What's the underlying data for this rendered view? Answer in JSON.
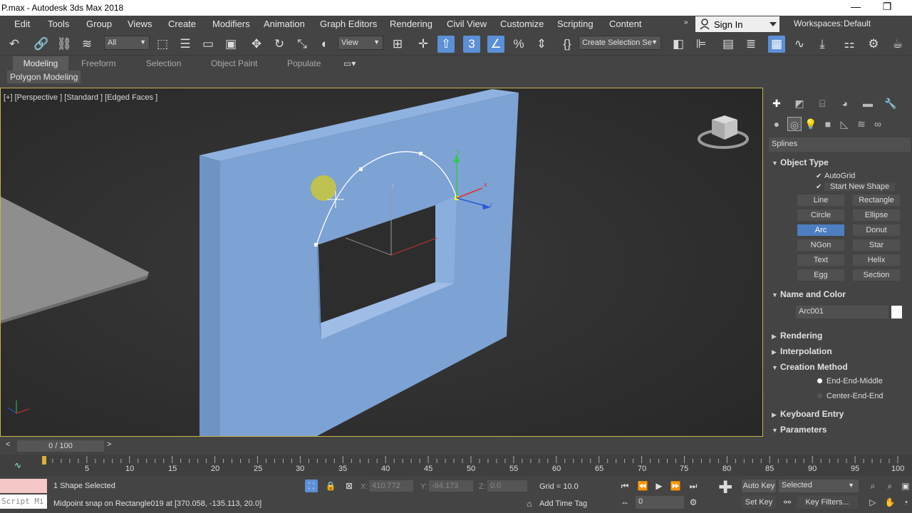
{
  "window": {
    "title": "P.max - Autodesk 3ds Max 2018",
    "minimize": "—",
    "restore": "❐"
  },
  "menu": {
    "items": [
      "Edit",
      "Tools",
      "Group",
      "Views",
      "Create",
      "Modifiers",
      "Animation",
      "Graph Editors",
      "Rendering",
      "Civil View",
      "Customize",
      "Scripting",
      "Content"
    ],
    "signin": "Sign In",
    "workspaces_label": "Workspaces:",
    "workspace_value": "Default"
  },
  "toolbar": {
    "filter_value": "All",
    "refcoord_value": "View",
    "named_selection_value": "Create Selection Se"
  },
  "ribbon": {
    "tabs": [
      "Modeling",
      "Freeform",
      "Selection",
      "Object Paint",
      "Populate"
    ],
    "active_tab": "Modeling",
    "panel_button": "Polygon Modeling"
  },
  "viewport": {
    "label": "[+] [Perspective ] [Standard ] [Edged Faces ]",
    "gizmo_axes": {
      "x": "x",
      "y": "y",
      "z": "z"
    },
    "pivot_label": "z"
  },
  "command_panel": {
    "category": "Splines",
    "object_type": {
      "header": "Object Type",
      "autogrid_label": "AutoGrid",
      "start_new_shape_label": "Start New Shape",
      "buttons": [
        "Line",
        "Rectangle",
        "Circle",
        "Ellipse",
        "Arc",
        "Donut",
        "NGon",
        "Star",
        "Text",
        "Helix",
        "Egg",
        "Section"
      ],
      "active_button": "Arc"
    },
    "name_and_color": {
      "header": "Name and Color",
      "name": "Arc001",
      "color": "#ffffff"
    },
    "rollouts_collapsed": [
      "Rendering",
      "Interpolation"
    ],
    "creation_method": {
      "header": "Creation Method",
      "options": [
        "End-End-Middle",
        "Center-End-End"
      ],
      "selected": "End-End-Middle"
    },
    "rollouts_collapsed_2": [
      "Keyboard Entry",
      "Parameters"
    ]
  },
  "timeline": {
    "slider_label": "0 / 100",
    "ticks": [
      "5",
      "10",
      "15",
      "20",
      "25",
      "30",
      "35",
      "40",
      "45",
      "50",
      "55",
      "60",
      "65",
      "70",
      "75",
      "80",
      "85",
      "90",
      "95",
      "100"
    ]
  },
  "status": {
    "selection": "1 Shape Selected",
    "prompt": "Midpoint snap on Rectangle019 at [370.058, -135.113, 20.0]",
    "x_label": "X:",
    "x_value": "410.772",
    "y_label": "Y:",
    "y_value": "-84.173",
    "z_label": "Z:",
    "z_value": "0.0",
    "grid": "Grid = 10.0",
    "add_time_tag": "Add Time Tag",
    "auto_key": "Auto Key",
    "set_key": "Set Key",
    "selected_dropdown": "Selected",
    "key_filters": "Key Filters...",
    "frame_value": "0",
    "maxscript_text": "Script Mi"
  }
}
